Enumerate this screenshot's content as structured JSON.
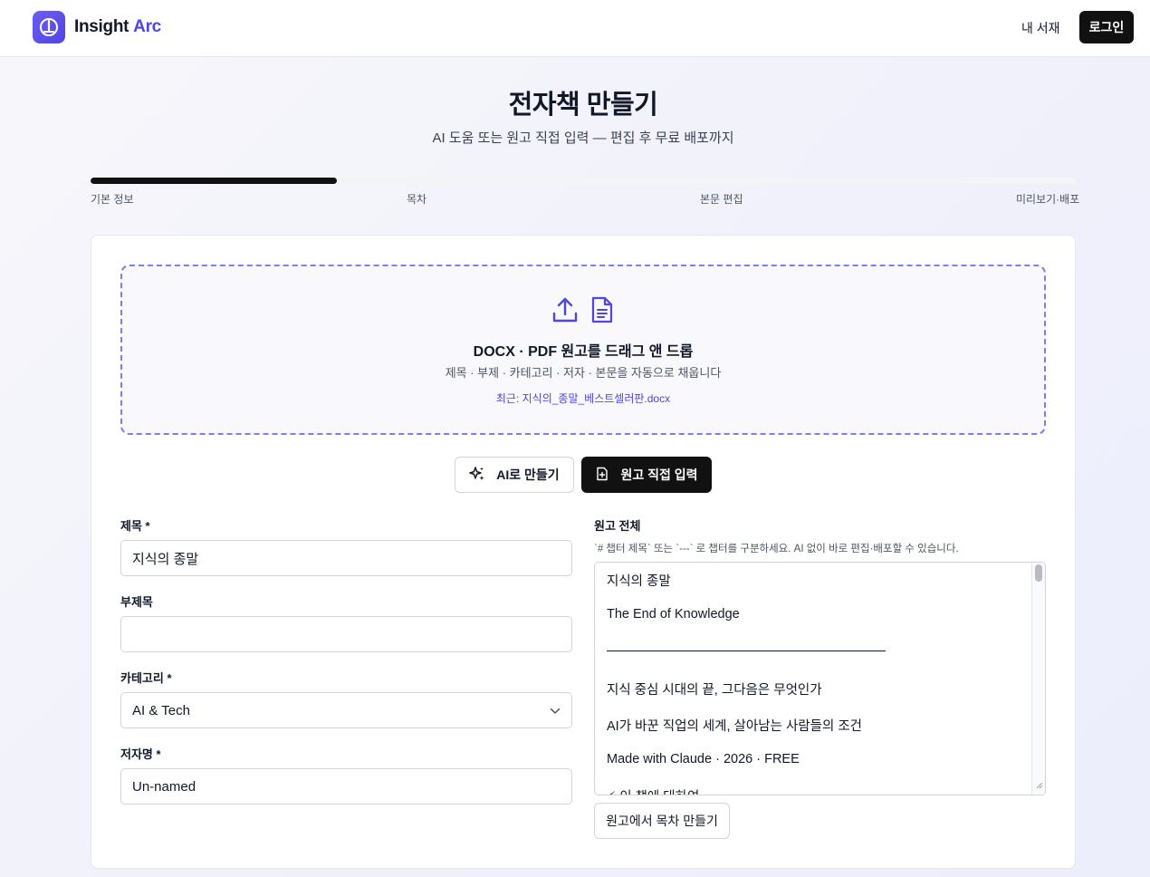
{
  "header": {
    "brand_name": "Insight",
    "brand_accent": "Arc",
    "library_link": "내 서재",
    "login_button": "로그인"
  },
  "hero": {
    "title": "전자책 만들기",
    "subtitle": "AI 도움 또는 원고 직접 입력 — 편집 후 무료 배포까지"
  },
  "progress": {
    "completed_fraction": 0.25,
    "steps": [
      "기본 정보",
      "목차",
      "본문 편집",
      "미리보기·배포"
    ]
  },
  "upload": {
    "title": "DOCX · PDF 원고를 드래그 앤 드롭",
    "description": "제목 · 부제 · 카테고리 · 저자 · 본문을 자동으로 채웁니다",
    "recent": "최근: 지식의_종말_베스트셀러판.docx",
    "icons": [
      "upload-icon",
      "document-icon"
    ]
  },
  "modes": {
    "ai_label": "AI로 만들기",
    "manual_label": "원고 직접 입력",
    "selected": "manual"
  },
  "form": {
    "title_label": "제목 *",
    "title_value": "지식의 종말",
    "subtitle_label": "부제목",
    "subtitle_value": "",
    "category_label": "카테고리 *",
    "category_value": "AI & Tech",
    "author_label": "저자명 *",
    "author_value": "Un-named"
  },
  "manuscript": {
    "label": "원고 전체",
    "hint": "`# 챕터 제목` 또는 `---` 로 챕터를 구분하세요. AI 없이 바로 편집·배포할 수 있습니다.",
    "lines": [
      "지식의 종말",
      "The End of Knowledge",
      "지식 중심 시대의 끝, 그다음은 무엇인가",
      "AI가 바꾼 직업의 세계, 살아남는 사람들의 조건",
      "Made with Claude  ·  2026  ·  FREE",
      "⚡ 이 책에 대하여"
    ],
    "toc_button": "원고에서 목차 만들기"
  },
  "colors": {
    "accent": "#4f46e5",
    "dark": "#111111",
    "dropzone_border": "#7c7ff0"
  }
}
